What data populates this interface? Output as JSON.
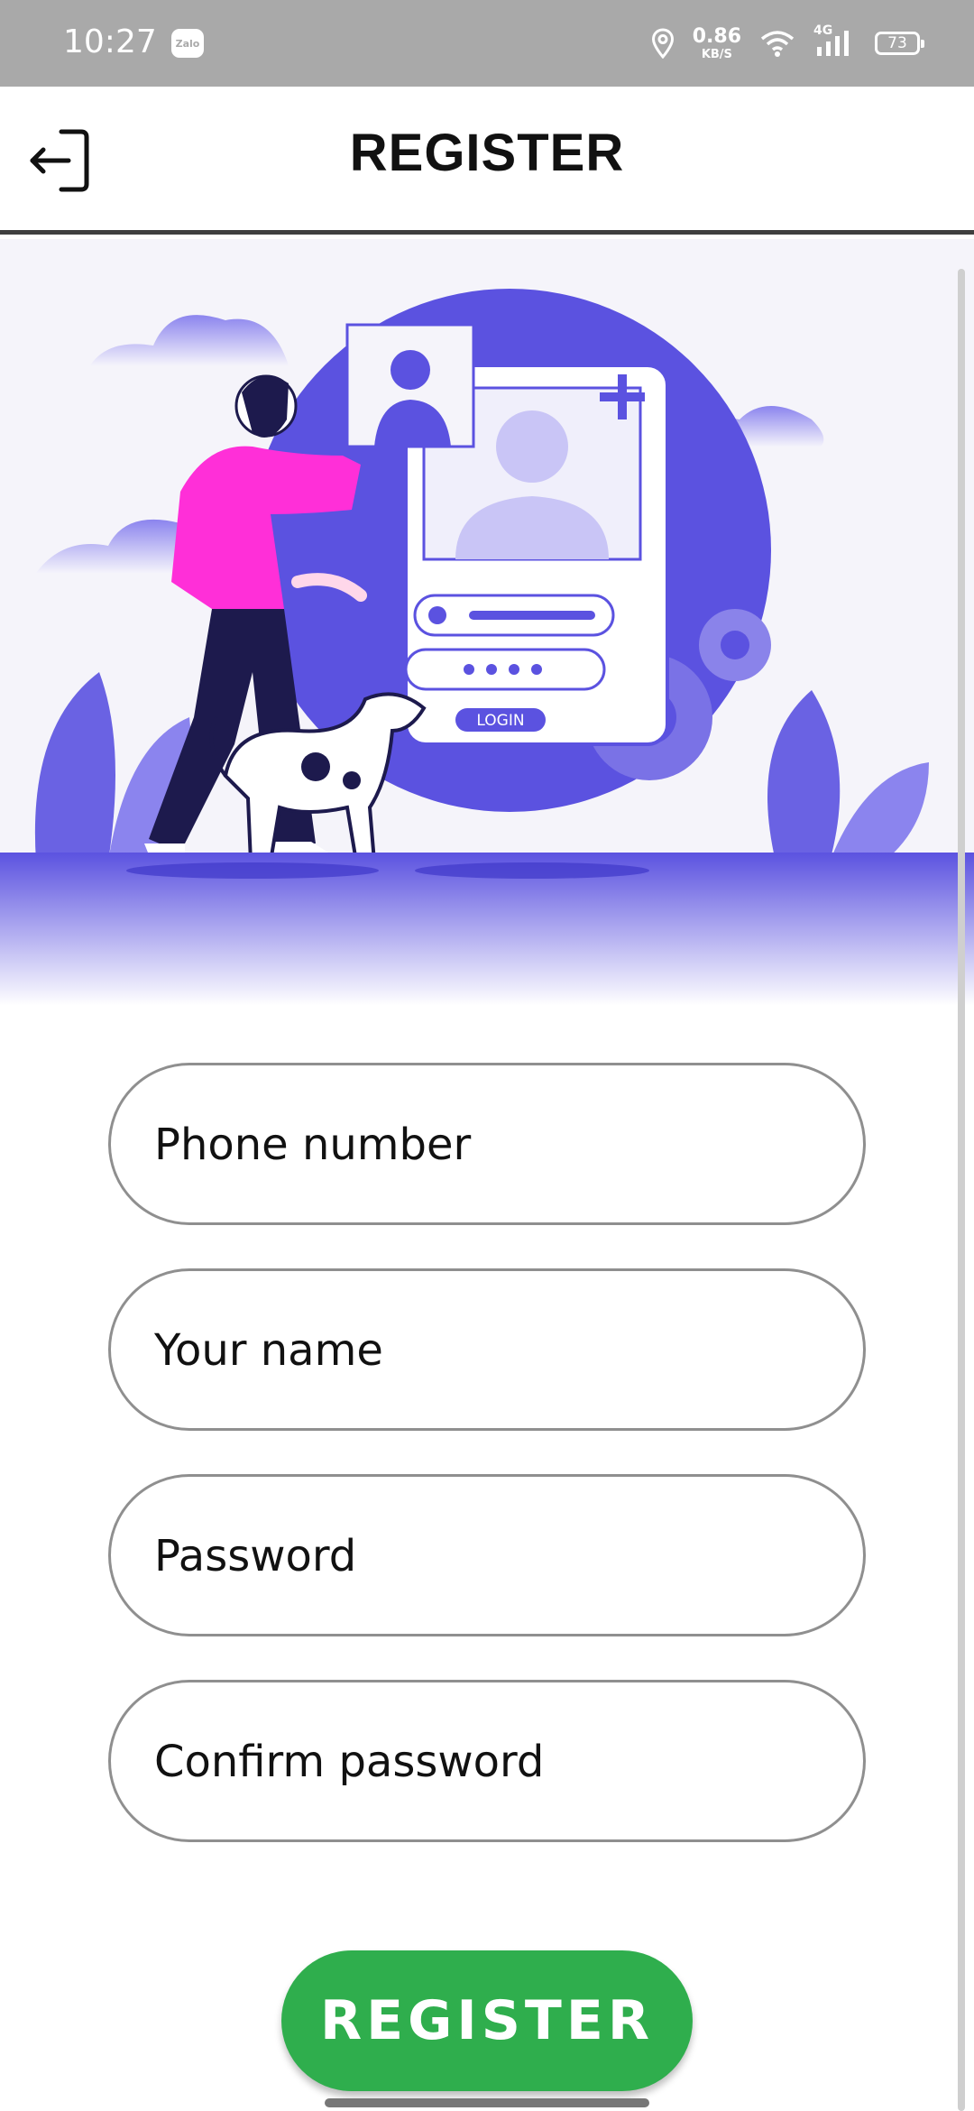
{
  "status_bar": {
    "time": "10:27",
    "app_badge": "Zalo",
    "net_speed_value": "0.86",
    "net_speed_unit": "KB/S",
    "network_type": "4G",
    "battery": "73"
  },
  "header": {
    "title": "REGISTER"
  },
  "illustration": {
    "login_label": "LOGIN"
  },
  "form": {
    "phone_placeholder": "Phone number",
    "name_placeholder": "Your name",
    "password_placeholder": "Password",
    "confirm_placeholder": "Confirm password"
  },
  "actions": {
    "register_label": "REGISTER"
  },
  "colors": {
    "accent_purple": "#5b52e0",
    "shirt_pink": "#ff2fd8",
    "button_green": "#2fae4d"
  }
}
